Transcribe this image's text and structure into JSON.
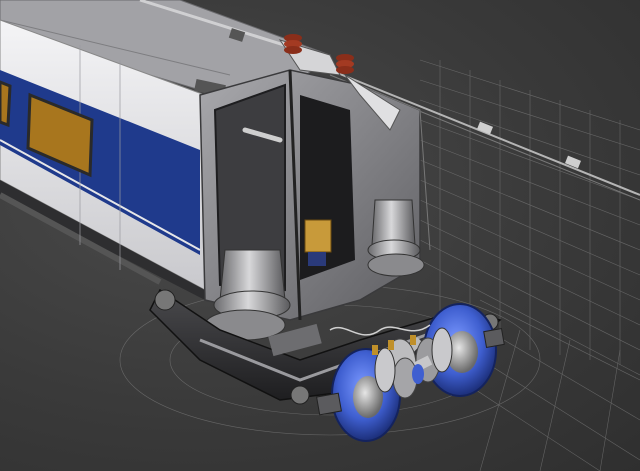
{
  "scene": {
    "subject": "train-car-bogie-wireframe-render",
    "colors": {
      "background": "#3a3a3a",
      "car_white": "#e8e8ea",
      "car_blue": "#1f3a8c",
      "body_gray": "#8f8f92",
      "dark_gray": "#2e2e30",
      "window_amber": "#a8761e",
      "wheel_blue": "#3f5fd0",
      "insulator_red": "#8a2e1a",
      "wire_line": "#9a9a9a",
      "crate": "#c89a3a"
    }
  }
}
